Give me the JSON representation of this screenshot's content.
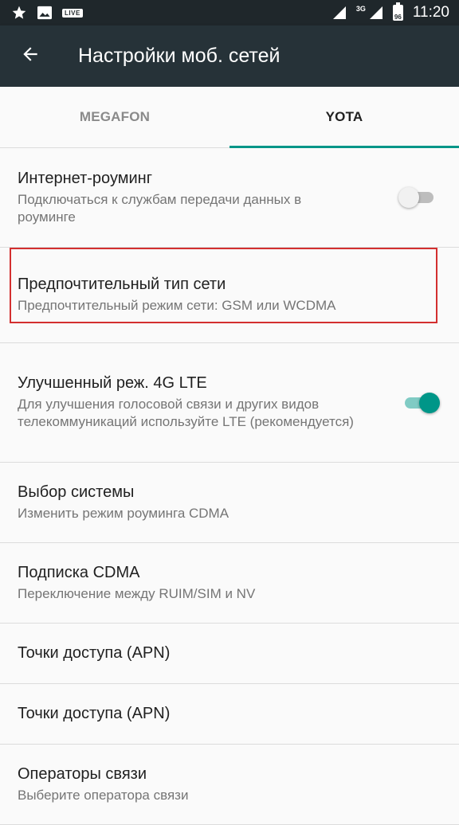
{
  "status_bar": {
    "network_type": "3G",
    "battery": "96",
    "live_badge": "LIVE",
    "time": "11:20"
  },
  "toolbar": {
    "title": "Настройки моб. сетей"
  },
  "tabs": [
    {
      "label": "MEGAFON",
      "active": false
    },
    {
      "label": "YOTA",
      "active": true
    }
  ],
  "list": [
    {
      "title": "Интернет-роуминг",
      "summary": "Подключаться к службам передачи данных в роуминге",
      "switch": "off"
    },
    {
      "title": "Предпочтительный тип сети",
      "summary": "Предпочтительный режим сети: GSM или WCDMA"
    },
    {
      "title": "Улучшенный реж. 4G LTE",
      "summary": "Для улучшения голосовой связи и других видов телекоммуникаций используйте LTE (рекомендуется)",
      "switch": "on"
    },
    {
      "title": "Выбор системы",
      "summary": "Изменить режим роуминга CDMA"
    },
    {
      "title": "Подписка CDMA",
      "summary": "Переключение между RUIM/SIM и NV"
    },
    {
      "title": "Точки доступа (APN)"
    },
    {
      "title": "Точки доступа (APN)"
    },
    {
      "title": "Операторы связи",
      "summary": "Выберите оператора связи"
    }
  ],
  "colors": {
    "accent": "#009688",
    "toolbar": "#263238",
    "status_bar": "#1f272b",
    "highlight": "#d32f2f"
  }
}
